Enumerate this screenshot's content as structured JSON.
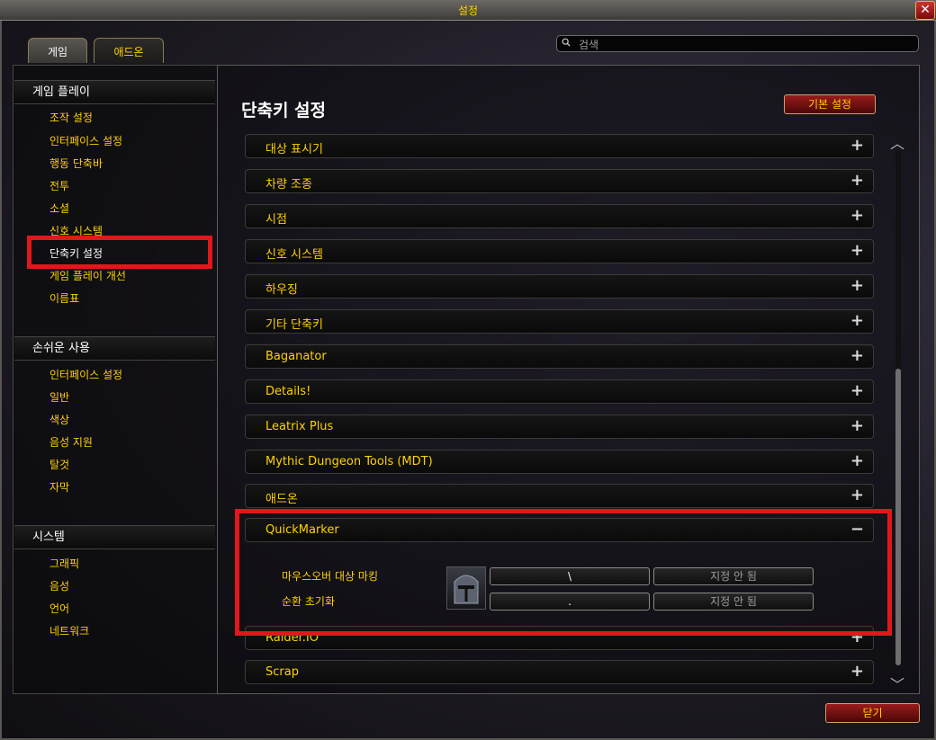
{
  "window": {
    "title": "설정",
    "close_symbol": "✕"
  },
  "tabs": [
    {
      "label": "게임"
    },
    {
      "label": "애드온"
    }
  ],
  "search": {
    "placeholder": "검색",
    "value": ""
  },
  "sidebar": {
    "sections": [
      {
        "header": "게임 플레이",
        "items": [
          "조작 설정",
          "인터페이스 설정",
          "행동 단축바",
          "전투",
          "소셜",
          "신호 시스템",
          "단축키 설정",
          "게임 플레이 개선",
          "이름표"
        ]
      },
      {
        "header": "손쉬운 사용",
        "items": [
          "인터페이스 설정",
          "일반",
          "색상",
          "음성 지원",
          "탈것",
          "자막"
        ]
      },
      {
        "header": "시스템",
        "items": [
          "그래픽",
          "음성",
          "언어",
          "네트워크"
        ]
      }
    ],
    "active_item": "단축키 설정"
  },
  "main": {
    "title": "단축키 설정",
    "defaults_button": "기본 설정",
    "expand_symbol": "+",
    "collapse_symbol": "−",
    "categories": [
      "대상 표시기",
      "차량 조종",
      "시점",
      "신호 시스템",
      "하우징",
      "기타 단축키",
      "Baganator",
      "Details!",
      "Leatrix Plus",
      "Mythic Dungeon Tools (MDT)",
      "애드온"
    ],
    "expanded_category": {
      "name": "QuickMarker",
      "icon": "helmet-icon",
      "bindings": [
        {
          "label": "마우스오버 대상 마킹",
          "primary": "\\",
          "secondary": "지정 안 됨"
        },
        {
          "label": "순환 초기화",
          "primary": ".",
          "secondary": "지정 안 됨"
        }
      ]
    },
    "categories_after": [
      "Raider.IO",
      "Scrap"
    ]
  },
  "footer": {
    "close_button": "닫기"
  },
  "colors": {
    "highlight": "#e3171b",
    "accent": "#ffd100"
  }
}
